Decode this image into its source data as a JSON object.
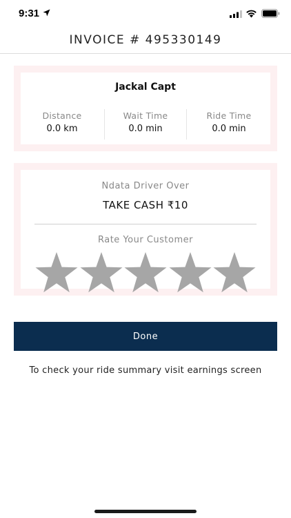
{
  "status_bar": {
    "time": "9:31"
  },
  "header": {
    "title": "INVOICE # 495330149"
  },
  "ride_card": {
    "driver_name": "Jackal Capt",
    "stats": [
      {
        "label": "Distance",
        "value": "0.0 km"
      },
      {
        "label": "Wait Time",
        "value": "0.0 min"
      },
      {
        "label": "Ride Time",
        "value": "0.0 min"
      }
    ]
  },
  "payment_card": {
    "over_label": "Ndata Driver Over",
    "cash_label": "TAKE CASH ₹10",
    "rate_label": "Rate Your Customer",
    "rating": {
      "value": 0,
      "max": 5
    }
  },
  "done_button": {
    "label": "Done"
  },
  "footer": {
    "text": "To check your ride summary visit earnings screen"
  },
  "colors": {
    "primary": "#0b2d4f",
    "card_border": "#fdf0f1",
    "star_inactive": "#a6a6a6"
  }
}
